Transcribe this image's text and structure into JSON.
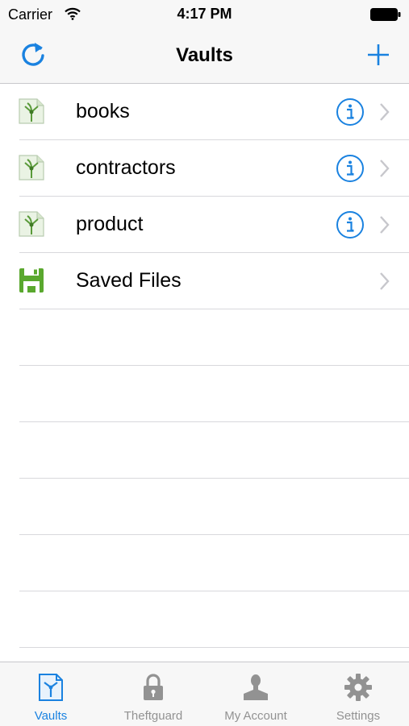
{
  "status_bar": {
    "carrier": "Carrier",
    "time": "4:17 PM"
  },
  "nav": {
    "title": "Vaults"
  },
  "vaults": [
    {
      "label": "books",
      "icon": "vault-file-icon",
      "has_info": true
    },
    {
      "label": "contractors",
      "icon": "vault-file-icon",
      "has_info": true
    },
    {
      "label": "product",
      "icon": "vault-file-icon",
      "has_info": true
    },
    {
      "label": "Saved Files",
      "icon": "saved-files-icon",
      "has_info": false
    }
  ],
  "tabs": [
    {
      "label": "Vaults",
      "icon": "vault-tab-icon",
      "active": true
    },
    {
      "label": "Theftguard",
      "icon": "lock-icon",
      "active": false
    },
    {
      "label": "My Account",
      "icon": "person-icon",
      "active": false
    },
    {
      "label": "Settings",
      "icon": "gear-icon",
      "active": false
    }
  ],
  "colors": {
    "accent": "#1a82e0",
    "inactive_tab": "#929292",
    "vault_green": "#5a9a3a"
  }
}
